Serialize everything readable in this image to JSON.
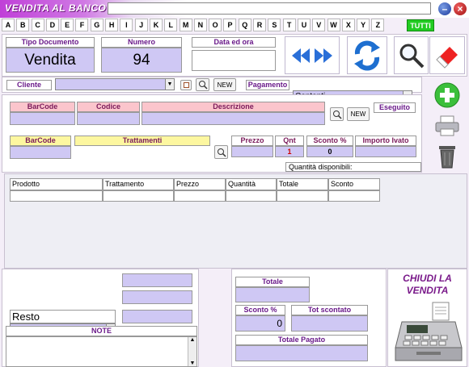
{
  "window": {
    "title": "VENDITA AL BANCO"
  },
  "alphabet": [
    "A",
    "B",
    "C",
    "D",
    "E",
    "F",
    "G",
    "H",
    "I",
    "J",
    "K",
    "L",
    "M",
    "N",
    "O",
    "P",
    "Q",
    "R",
    "S",
    "T",
    "U",
    "V",
    "W",
    "X",
    "Y",
    "Z"
  ],
  "tutti_label": "TUTTI",
  "header": {
    "tipo_documento_label": "Tipo Documento",
    "tipo_documento_value": "Vendita",
    "numero_label": "Numero",
    "numero_value": "94",
    "data_label": "Data ed ora",
    "data_value": ""
  },
  "cliente": {
    "label": "Cliente",
    "value": "",
    "new_label": "NEW"
  },
  "pagamento": {
    "label": "Pagamento",
    "value": "Contanti"
  },
  "product_row": {
    "barcode_label": "BarCode",
    "codice_label": "Codice",
    "descrizione_label": "Descrizione",
    "new_label": "NEW",
    "eseguito_label": "Eseguito"
  },
  "treatment_row": {
    "barcode_label": "BarCode",
    "trattamenti_label": "Trattamenti",
    "prezzo_label": "Prezzo",
    "qnt_label": "Qnt",
    "qnt_value": "1",
    "sconto_label": "Sconto %",
    "sconto_value": "0",
    "importo_label": "Importo Ivato",
    "quantita_disponibili": "Quantità disponibili:"
  },
  "table": {
    "columns": [
      "Prodotto",
      "Trattamento",
      "Prezzo",
      "Quantità",
      "Totale",
      "Sconto"
    ]
  },
  "bottom": {
    "resto_label": "Resto",
    "note_label": "NOTE",
    "totale_label": "Totale",
    "sconto_label": "Sconto %",
    "sconto_value": "0",
    "tot_scontato_label": "Tot scontato",
    "totale_pagato_label": "Totale Pagato",
    "chiudi_label": "CHIUDI LA VENDITA"
  },
  "colors": {
    "accent": "#c040d8",
    "label_text": "#6a1a8a",
    "value_fill": "#cfc8f4",
    "pink_header": "#fbc5cc",
    "yellow_header": "#fdf7a0",
    "tutti_green": "#22cc22"
  },
  "icons": [
    "minimize-icon",
    "close-icon",
    "rewind-icon",
    "fast-forward-icon",
    "refresh-icon",
    "search-icon",
    "eraser-icon",
    "add-icon",
    "printer-icon",
    "trash-icon",
    "cash-register-icon",
    "find-icon"
  ]
}
